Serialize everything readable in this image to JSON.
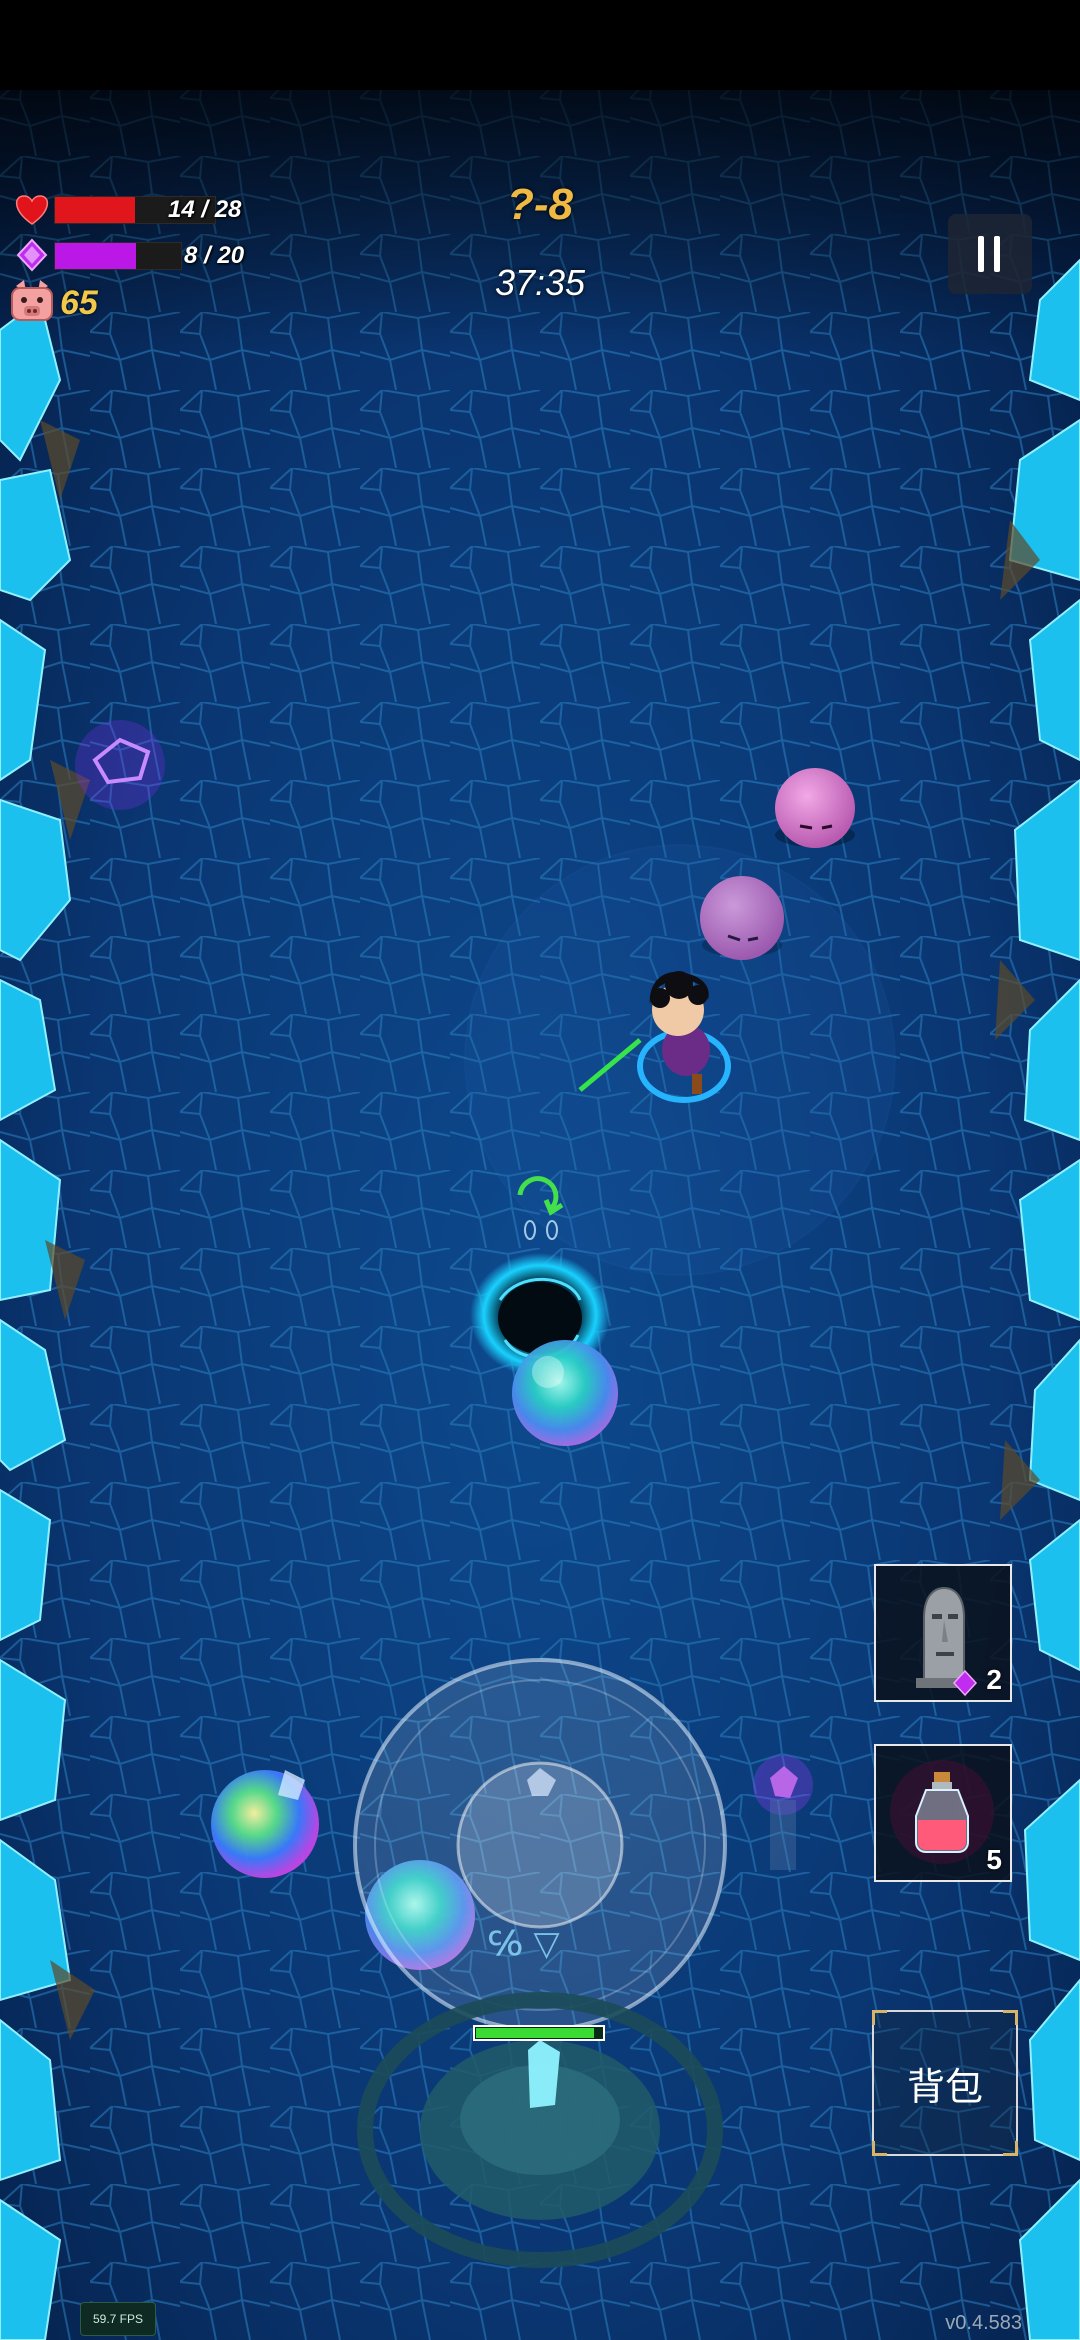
{
  "hud": {
    "health": {
      "current": 14,
      "max": 28,
      "text": "14 / 28",
      "color": "#e0161c"
    },
    "mana": {
      "current": 8,
      "max": 20,
      "text": "8 / 20",
      "color": "#bb17e6"
    },
    "coins": {
      "value": "65",
      "color": "#f2c84b"
    },
    "level": {
      "text": "?-8",
      "color": "#f0b944"
    },
    "timer": {
      "text": "37:35"
    }
  },
  "buttons": {
    "pause": "pause-icon",
    "backpack_label": "背包"
  },
  "inventory": {
    "slots": [
      {
        "icon": "stone-statue-icon",
        "count": "2",
        "cost_icon": "purple-gem-icon"
      },
      {
        "icon": "health-potion-icon",
        "count": "5"
      }
    ]
  },
  "scene": {
    "floor_color": "#0b3a74",
    "crystal_color": "#19c4f0",
    "enemies": [
      "pink-slime",
      "pink-slime"
    ],
    "player": "player-character",
    "portal": "swirl-portal",
    "orbs": [
      "rainbow-orb",
      "rainbow-orb",
      "rainbow-orb"
    ]
  },
  "footer": {
    "fps": "59.7 FPS",
    "version": "v0.4.583"
  }
}
